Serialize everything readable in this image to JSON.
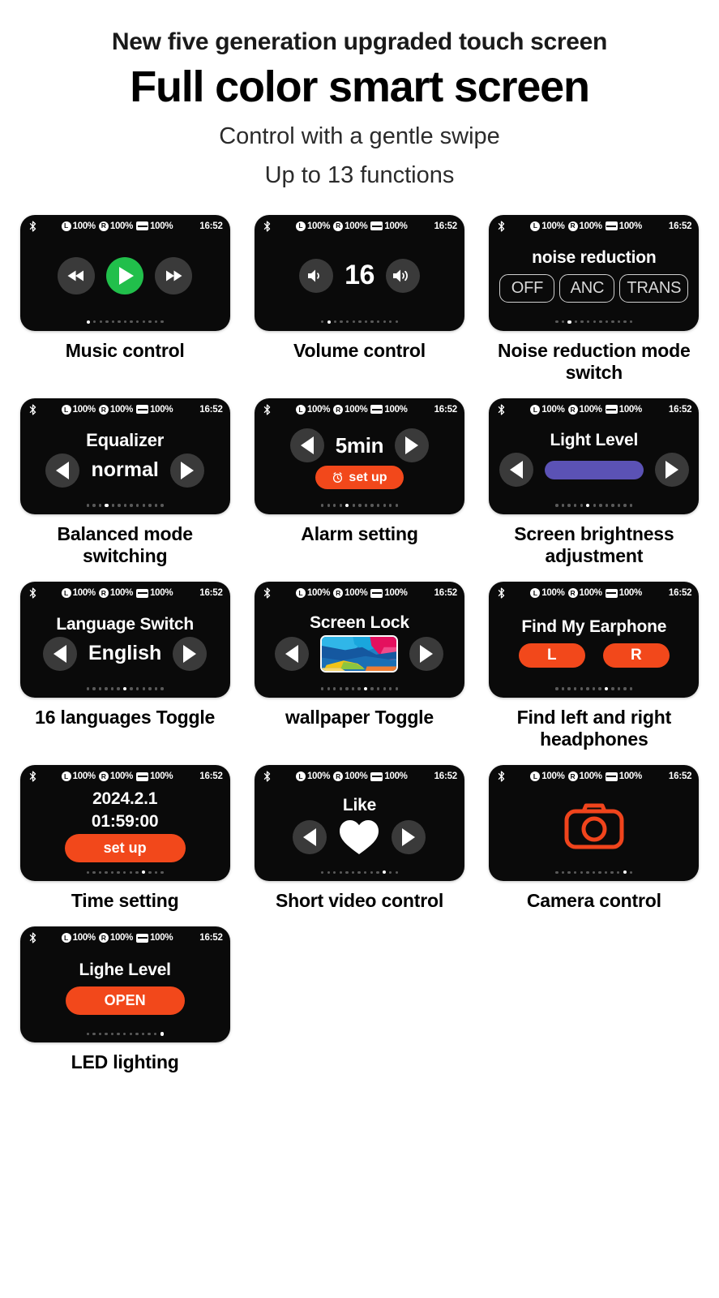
{
  "header": {
    "eyebrow": "New five generation upgraded touch screen",
    "title": "Full color smart screen",
    "subtitle": "Control with a gentle swipe",
    "subtitle2": "Up to 13 functions"
  },
  "status_bar": {
    "bluetooth_icon": "bluetooth-icon",
    "left_label": "L",
    "left_battery": "100%",
    "right_label": "R",
    "right_battery": "100%",
    "case_battery": "100%",
    "time": "16:52"
  },
  "colors": {
    "screen_bg": "#0a0a0a",
    "accent_orange": "#f2481b",
    "accent_green": "#21bf4b",
    "accent_purple": "#5b52b5",
    "button_gray": "#3a3a3a",
    "dot_active": "#ffffff",
    "dot_inactive": "#5a5a5a"
  },
  "page_dots": {
    "total": 13
  },
  "cards": [
    {
      "id": "music-control",
      "caption": "Music control",
      "active_dot": 1,
      "controls": {
        "prev_icon": "rewind-icon",
        "play_icon": "play-icon",
        "next_icon": "fast-forward-icon"
      }
    },
    {
      "id": "volume-control",
      "caption": "Volume control",
      "active_dot": 2,
      "value": "16",
      "controls": {
        "down_icon": "volume-down-icon",
        "up_icon": "volume-up-icon"
      }
    },
    {
      "id": "noise-reduction",
      "caption": "Noise reduction mode switch",
      "active_dot": 3,
      "title": "noise reduction",
      "options": [
        "OFF",
        "ANC",
        "TRANS"
      ]
    },
    {
      "id": "equalizer",
      "caption": "Balanced mode switching",
      "active_dot": 4,
      "title": "Equalizer",
      "value": "normal",
      "controls": {
        "prev_icon": "chevron-left-icon",
        "next_icon": "chevron-right-icon"
      }
    },
    {
      "id": "alarm-setting",
      "caption": "Alarm setting",
      "active_dot": 5,
      "value": "5min",
      "button_label": "set up",
      "button_icon": "alarm-clock-icon"
    },
    {
      "id": "screen-brightness",
      "caption": "Screen brightness adjustment",
      "active_dot": 6,
      "title": "Light Level",
      "slider_icon": "brightness-slider"
    },
    {
      "id": "language-switch",
      "caption": "16 languages Toggle",
      "active_dot": 7,
      "title": "Language Switch",
      "value": "English"
    },
    {
      "id": "screen-lock",
      "caption": "wallpaper Toggle",
      "active_dot": 8,
      "title": "Screen Lock",
      "thumbnail_icon": "wallpaper-thumbnail"
    },
    {
      "id": "find-my-earphone",
      "caption": "Find left and right headphones",
      "active_dot": 9,
      "title": "Find My Earphone",
      "left_button": "L",
      "right_button": "R"
    },
    {
      "id": "time-setting",
      "caption": "Time setting",
      "active_dot": 10,
      "date": "2024.2.1",
      "time": "01:59:00",
      "button_label": "set up"
    },
    {
      "id": "short-video-control",
      "caption": "Short video control",
      "active_dot": 11,
      "title": "Like",
      "center_icon": "heart-icon"
    },
    {
      "id": "camera-control",
      "caption": "Camera control",
      "active_dot": 12,
      "center_icon": "camera-icon"
    },
    {
      "id": "led-lighting",
      "caption": "LED lighting",
      "active_dot": 13,
      "title": "Lighe Level",
      "button_label": "OPEN"
    }
  ]
}
